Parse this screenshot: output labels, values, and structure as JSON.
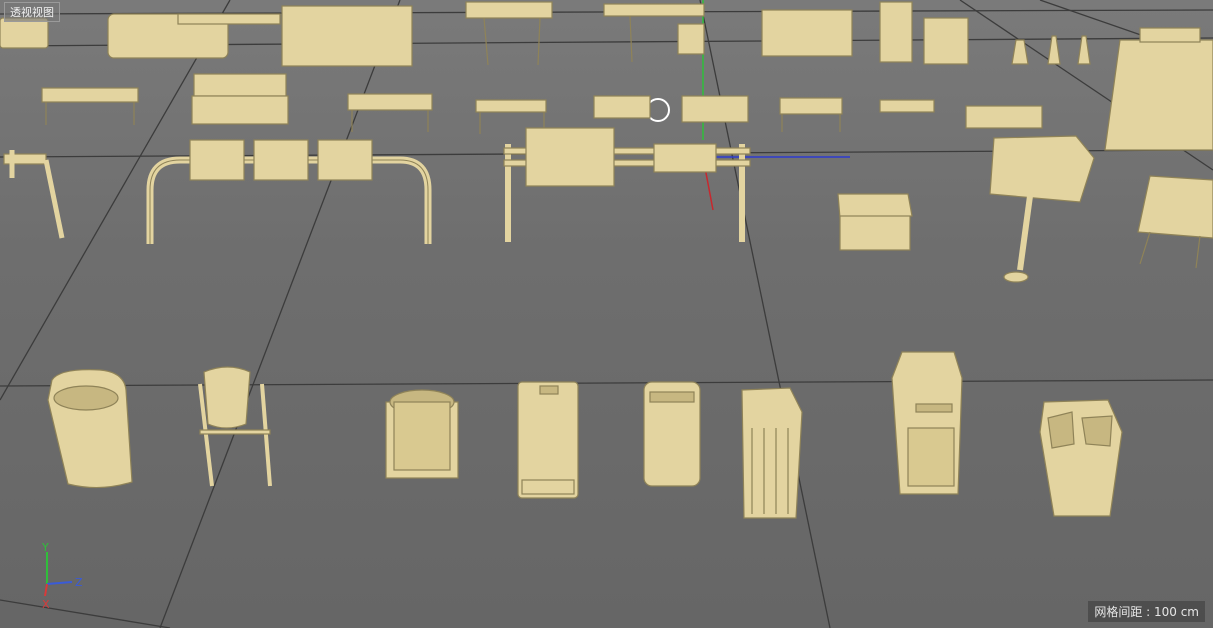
{
  "viewport": {
    "title": "透视视图",
    "grid_spacing": "网格间距 : 100 cm"
  },
  "axes": {
    "y_label": "Y",
    "z_label": "Z",
    "x_label": "X",
    "y_color": "#2fbf3a",
    "z_color": "#3a5bd8",
    "x_color": "#d83a3a"
  },
  "colors": {
    "model": "#e3d4a0",
    "model_edge": "#8f8358",
    "model_shade": "#c7b781",
    "grid_line": "#3c3c3c",
    "background": "#6b6b6b"
  },
  "objects": [
    "bus-shelter",
    "bench",
    "guard-rail",
    "sign-board",
    "billboard",
    "dumpster",
    "trash-bin-oval",
    "trash-bin-stand",
    "trash-bin-round",
    "trash-bin-tall",
    "trash-bin-cabinet",
    "recycling-bin"
  ]
}
